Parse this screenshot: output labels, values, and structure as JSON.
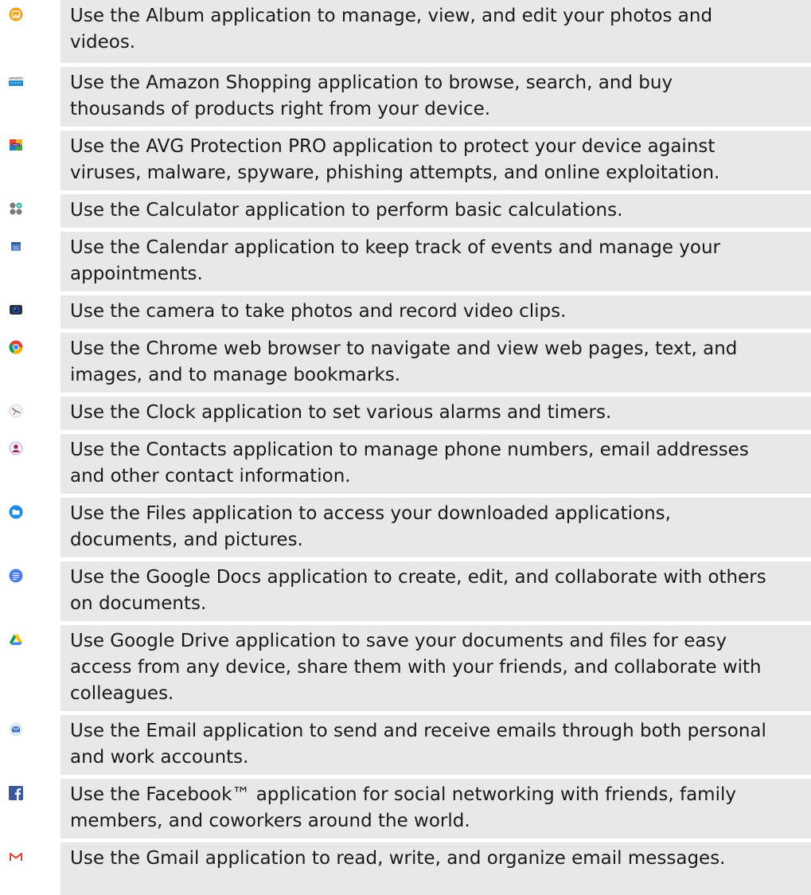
{
  "apps": [
    {
      "icon": "album-icon",
      "lines": [
        "Use the Album application to manage, view, and edit your photos and",
        "videos."
      ]
    },
    {
      "icon": "amazon-shopping-icon",
      "lines": [
        "Use the Amazon Shopping application to browse, search, and buy",
        "thousands of products right from your device."
      ]
    },
    {
      "icon": "avg-protection-icon",
      "lines": [
        "Use the AVG Protection PRO application to protect your device against",
        "viruses, malware, spyware, phishing attempts, and online exploitation."
      ]
    },
    {
      "icon": "calculator-icon",
      "lines": [
        "Use the Calculator application to perform basic calculations."
      ]
    },
    {
      "icon": "calendar-icon",
      "lines": [
        "Use the Calendar application to keep track of events and manage your",
        "appointments."
      ]
    },
    {
      "icon": "camera-icon",
      "lines": [
        "Use the camera to take photos and record video clips."
      ]
    },
    {
      "icon": "chrome-icon",
      "lines": [
        "Use the Chrome web browser to navigate and view web pages, text, and",
        "images, and to manage bookmarks."
      ]
    },
    {
      "icon": "clock-icon",
      "lines": [
        "Use the Clock application to set various alarms and timers."
      ]
    },
    {
      "icon": "contacts-icon",
      "lines": [
        "Use the Contacts application to manage phone numbers, email addresses",
        "and other contact information."
      ]
    },
    {
      "icon": "files-icon",
      "lines": [
        "Use the Files application to access your downloaded applications,",
        "documents, and pictures."
      ]
    },
    {
      "icon": "google-docs-icon",
      "lines": [
        "Use the Google Docs application to create, edit, and collaborate with others",
        "on documents."
      ]
    },
    {
      "icon": "google-drive-icon",
      "lines": [
        "Use Google Drive application to save your documents and files for easy",
        "access from any device, share them with your friends, and collaborate with",
        "colleagues."
      ]
    },
    {
      "icon": "email-icon",
      "lines": [
        "Use the Email application to send and receive emails through both personal",
        "and work accounts."
      ]
    },
    {
      "icon": "facebook-icon",
      "lines": [
        "Use the Facebook™ application for social networking with friends, family",
        "members, and coworkers around the world."
      ]
    },
    {
      "icon": "gmail-icon",
      "lines": [
        "Use the Gmail application to read, write, and organize email messages."
      ]
    }
  ],
  "colors": {
    "row_background": "#e8e8e8",
    "text": "#1a1a1a"
  }
}
